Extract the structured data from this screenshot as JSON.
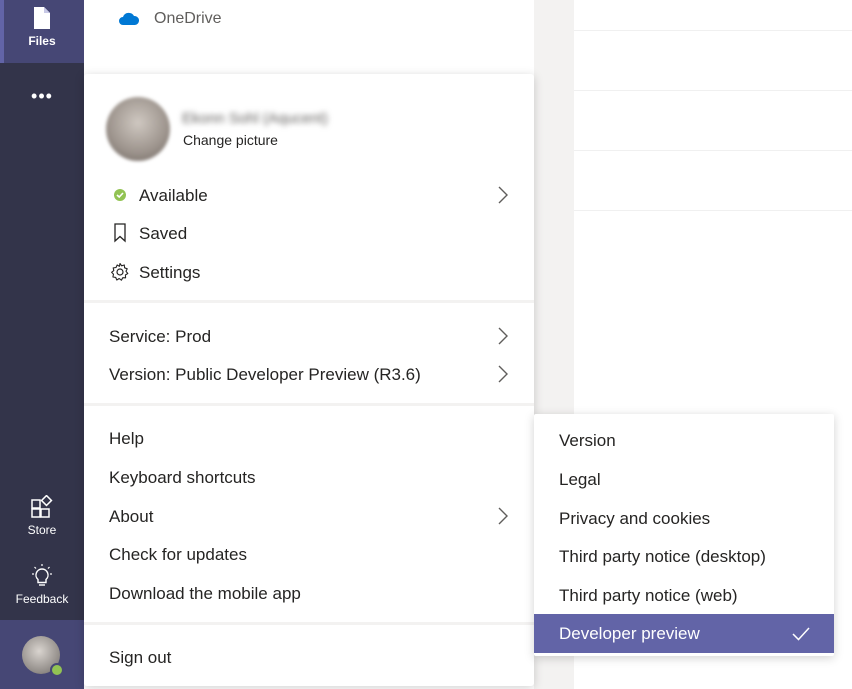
{
  "rail": {
    "files_label": "Files",
    "more_label": "•••",
    "store_label": "Store",
    "feedback_label": "Feedback",
    "accent": "#6264a7",
    "presence_color": "#92c353"
  },
  "list": {
    "onedrive_label": "OneDrive"
  },
  "profile_menu": {
    "user_name": "Ekonn Sohl (Aqucent)",
    "change_picture": "Change picture",
    "status_label": "Available",
    "saved_label": "Saved",
    "settings_label": "Settings",
    "service_label": "Service: Prod",
    "version_label": "Version: Public Developer Preview (R3.6)",
    "help_label": "Help",
    "shortcuts_label": "Keyboard shortcuts",
    "about_label": "About",
    "updates_label": "Check for updates",
    "mobile_app_label": "Download the mobile app",
    "sign_out_label": "Sign out"
  },
  "about_submenu": {
    "items": [
      "Version",
      "Legal",
      "Privacy and cookies",
      "Third party notice (desktop)",
      "Third party notice (web)"
    ],
    "selected": "Developer preview"
  }
}
